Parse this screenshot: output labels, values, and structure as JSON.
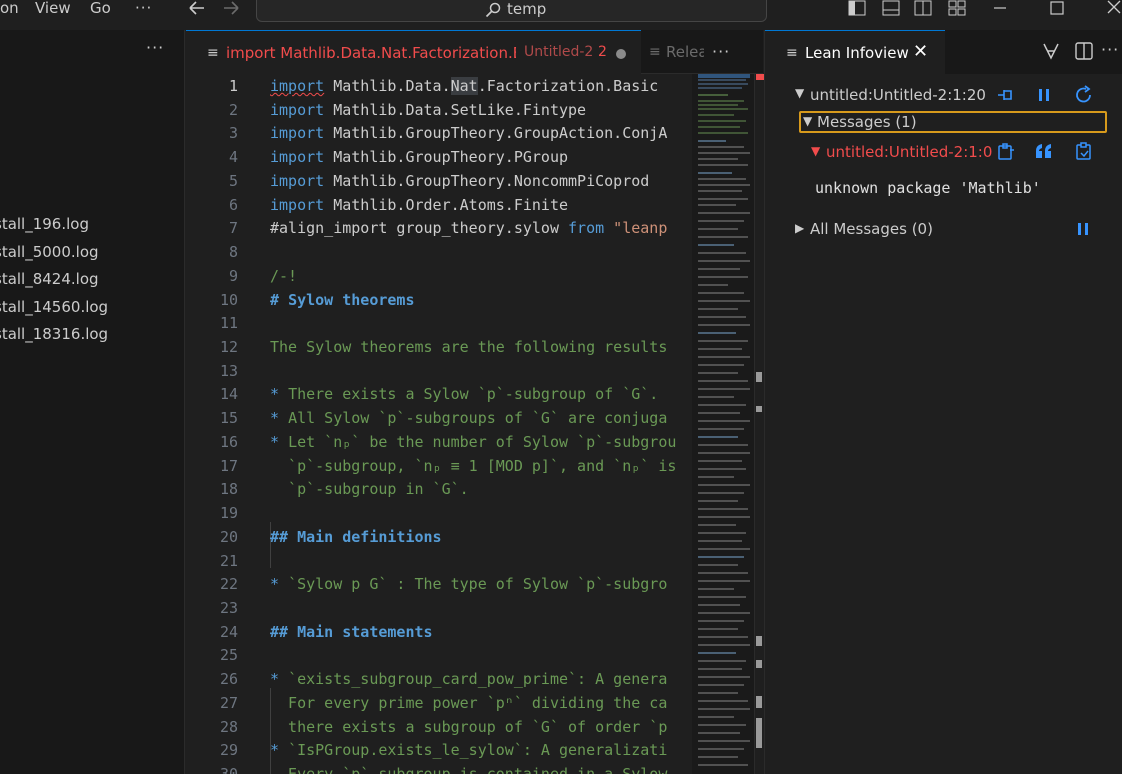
{
  "menu": {
    "items": [
      "on",
      "View",
      "Go"
    ],
    "more": "···"
  },
  "search": {
    "query": "temp"
  },
  "sidebar": {
    "more": "···",
    "files": [
      "stall_196.log",
      "stall_5000.log",
      "stall_8424.log",
      "stall_14560.log",
      "stall_18316.log"
    ]
  },
  "editor": {
    "active_tab": {
      "name": "import Mathlib.Data.Nat.Factorization.Ba",
      "description": "Untitled-2",
      "problems": "2"
    },
    "second_tab": {
      "name": "Relea",
      "more": "···"
    },
    "line_numbers": [
      "1",
      "2",
      "3",
      "4",
      "5",
      "6",
      "7",
      "8",
      "9",
      "10",
      "11",
      "12",
      "13",
      "14",
      "15",
      "16",
      "17",
      "18",
      "19",
      "20",
      "21",
      "22",
      "23",
      "24",
      "25",
      "26",
      "27",
      "28",
      "29",
      "30"
    ],
    "lines": {
      "l1_kw": "import",
      "l1_a": " Mathlib.Data.",
      "l1_b": "Nat",
      "l1_c": ".Factorization.Basic",
      "l2_kw": "import",
      "l2_r": " Mathlib.Data.SetLike.Fintype",
      "l3_kw": "import",
      "l3_r": " Mathlib.GroupTheory.GroupAction.ConjA",
      "l4_kw": "import",
      "l4_r": " Mathlib.GroupTheory.PGroup",
      "l5_kw": "import",
      "l5_r": " Mathlib.GroupTheory.NoncommPiCoprod",
      "l6_kw": "import",
      "l6_r": " Mathlib.Order.Atoms.Finite",
      "l7_a": "#align_import group_theory.sylow ",
      "l7_kw": "from",
      "l7_str": " \"leanp",
      "l9": "/-!",
      "l10_hash": "# ",
      "l10_t": "Sylow theorems",
      "l12": "The Sylow theorems are the following results",
      "l14_b": "* ",
      "l14_t": "There exists a Sylow `p`-subgroup of `G`.",
      "l15_b": "* ",
      "l15_t": "All Sylow `p`-subgroups of `G` are conjuga",
      "l16_b": "* ",
      "l16_t": "Let `nₚ` be the number of Sylow `p`-subgrou",
      "l17": "  `p`-subgroup, `nₚ ≡ 1 [MOD p]`, and `nₚ` is",
      "l18": "  `p`-subgroup in `G`.",
      "l20_hash": "## ",
      "l20_t": "Main definitions",
      "l22_b": "* ",
      "l22_t": "`Sylow p G` : The type of Sylow `p`-subgro",
      "l24_hash": "## ",
      "l24_t": "Main statements",
      "l26_b": "* ",
      "l26_t": "`exists_subgroup_card_pow_prime`: A genera",
      "l27": "  For every prime power `pⁿ` dividing the ca",
      "l28": "  there exists a subgroup of `G` of order `p",
      "l29_b": "* ",
      "l29_t": "`IsPGroup.exists_le_sylow`: A generalizati",
      "l30": "  Every `p`-subgroup is contained in a Sylow"
    }
  },
  "infoview": {
    "tab_label": "Lean Infoview",
    "location": "untitled:Untitled-2:1:20",
    "messages_header": "Messages (1)",
    "error_location": "untitled:Untitled-2:1:0",
    "error_message": "unknown package 'Mathlib'",
    "all_messages": "All Messages (0)"
  },
  "colors": {
    "accent": "#0078d4",
    "error": "#f14c4c",
    "focus_outline": "#d79a1c",
    "link_blue": "#3794ff"
  }
}
